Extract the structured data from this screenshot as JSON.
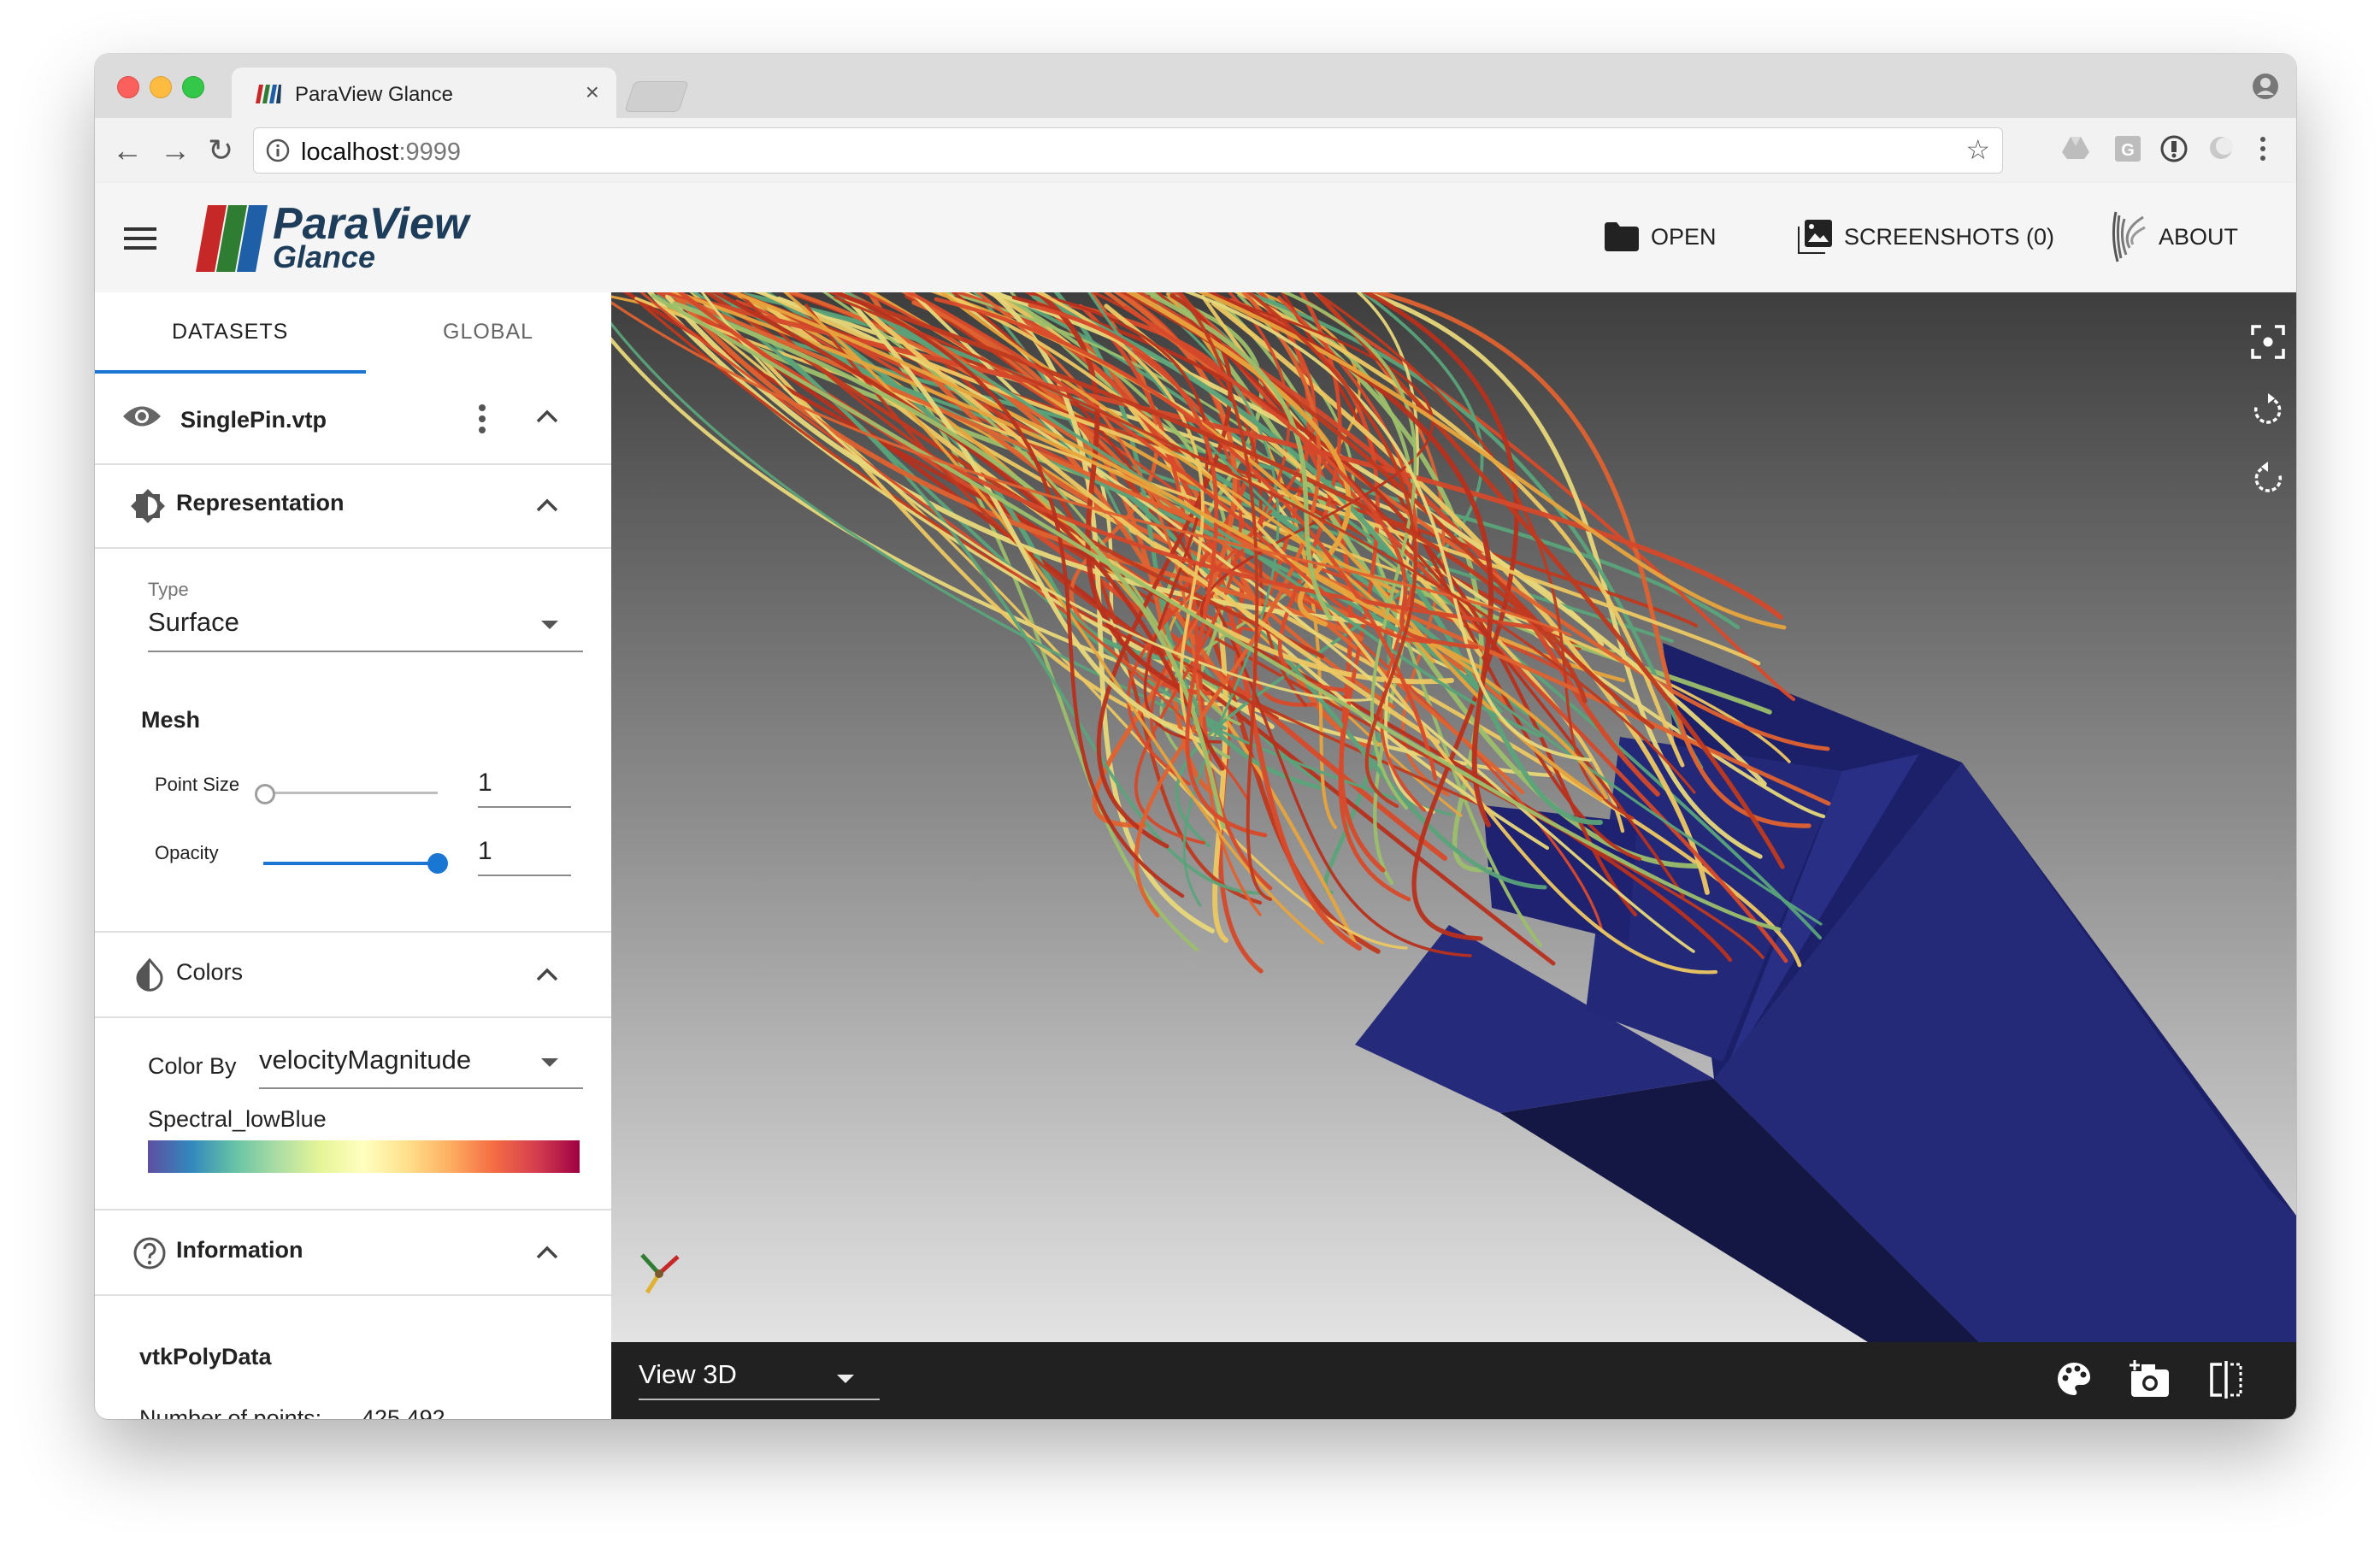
{
  "browser": {
    "tab_title": "ParaView Glance",
    "tab_close": "×",
    "url_host": "localhost",
    "url_port": ":9999",
    "nav": {
      "back": "←",
      "forward": "→",
      "reload": "↻"
    },
    "star": "☆"
  },
  "toolbar": {
    "brand_name": "ParaView",
    "brand_sub": "Glance",
    "open_label": "OPEN",
    "screenshots_label": "SCREENSHOTS (0)",
    "about_label": "ABOUT"
  },
  "sidebar": {
    "tabs": [
      {
        "label": "DATASETS",
        "active": true
      },
      {
        "label": "GLOBAL",
        "active": false
      }
    ],
    "dataset_name": "SinglePin.vtp",
    "representation": {
      "title": "Representation",
      "type_label": "Type",
      "type_value": "Surface",
      "mesh_label": "Mesh",
      "point_size_label": "Point Size",
      "point_size_value": "1",
      "point_size_fraction": 0.0,
      "opacity_label": "Opacity",
      "opacity_value": "1",
      "opacity_fraction": 1.0
    },
    "colors": {
      "title": "Colors",
      "color_by_label": "Color By",
      "color_by_value": "velocityMagnitude",
      "colormap_name": "Spectral_lowBlue",
      "colormap_stops": [
        "#5e4fa2",
        "#3288bd",
        "#66c2a5",
        "#abdda4",
        "#e6f598",
        "#ffffbf",
        "#fee08b",
        "#fdae61",
        "#f46d43",
        "#d53e4f",
        "#9e0142"
      ]
    },
    "information": {
      "title": "Information",
      "data_type": "vtkPolyData",
      "points_label": "Number of points:",
      "points_value": "425 492"
    }
  },
  "view": {
    "view_type": "View 3D",
    "background_top": "#3e3e3e",
    "background_bottom": "#e3e3e3",
    "geometry_color": "#252a78"
  },
  "colors": {
    "accent": "#1976d2",
    "dark_bar": "#212121",
    "brand_red": "#c62828",
    "brand_green": "#2e7d32",
    "brand_blue": "#1f5fa8"
  },
  "icons": [
    "hamburger-icon",
    "folder-icon",
    "images-icon",
    "kitware-icon",
    "eye-icon",
    "more-vert-icon",
    "chevron-up-icon",
    "brightness-icon",
    "invert-colors-icon",
    "help-circle-icon",
    "center-focus-icon",
    "rotate-left-icon",
    "rotate-right-icon",
    "palette-icon",
    "camera-add-icon",
    "split-view-icon",
    "axes-orientation-icon"
  ]
}
